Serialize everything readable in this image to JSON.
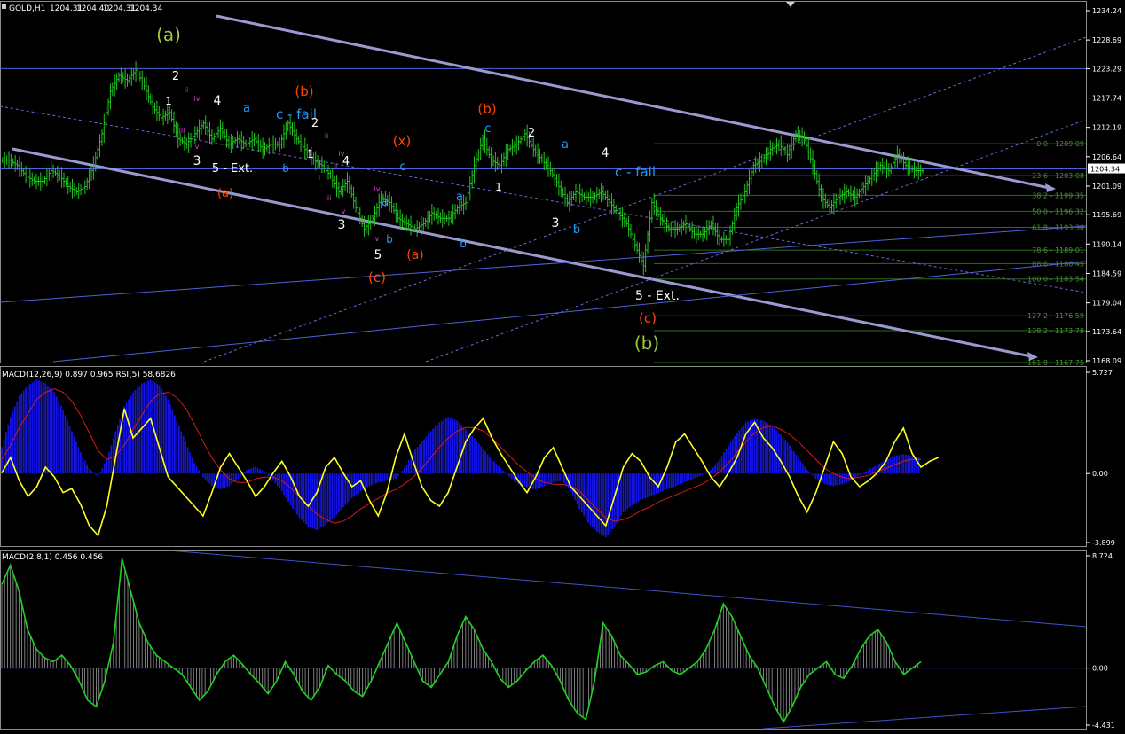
{
  "header": {
    "symbol": "GOLD,H1",
    "open": "1204.31",
    "high": "1204.40",
    "low": "1204.31",
    "close": "1204.34",
    "indicator1": "MACD(12,26,9) 0.897 0.965  RSI(5) 58.6826",
    "indicator2": "MACD(2,8,1) 0.456 0.456"
  },
  "chart_data": [
    {
      "type": "candlestick",
      "name": "price",
      "ylim": [
        1168.09,
        1234.24
      ],
      "yticks": [
        "1234.24",
        "1228.69",
        "1223.29",
        "1217.74",
        "1212.19",
        "1206.64",
        "1201.09",
        "1195.69",
        "1190.14",
        "1184.59",
        "1179.04",
        "1173.64",
        "1168.09"
      ],
      "current_price": "1204.34",
      "close_path": [
        1206,
        1205,
        1203,
        1202,
        1202,
        1204,
        1203,
        1201,
        1200,
        1201,
        1205,
        1211,
        1219,
        1222,
        1221,
        1223,
        1220,
        1216,
        1214,
        1215,
        1210,
        1209,
        1211,
        1213,
        1210,
        1212,
        1209,
        1210,
        1209,
        1210,
        1208,
        1209,
        1209,
        1213,
        1210,
        1208,
        1206,
        1205,
        1203,
        1200,
        1202,
        1197,
        1193,
        1195,
        1199,
        1198,
        1195,
        1194,
        1193,
        1194,
        1196,
        1195,
        1195,
        1197,
        1198,
        1205,
        1210,
        1206,
        1205,
        1208,
        1209,
        1211,
        1208,
        1206,
        1204,
        1201,
        1198,
        1200,
        1199,
        1199,
        1200,
        1198,
        1196,
        1194,
        1190,
        1186,
        1198,
        1195,
        1193,
        1193,
        1194,
        1192,
        1192,
        1194,
        1191,
        1191,
        1197,
        1200,
        1205,
        1206,
        1208,
        1209,
        1207,
        1211,
        1210,
        1205,
        1199,
        1197,
        1199,
        1200,
        1199,
        1201,
        1203,
        1205,
        1204,
        1207,
        1205,
        1204,
        1204
      ],
      "fib_levels": [
        {
          "label": "0.0 - 1209.09",
          "value": 1209.09
        },
        {
          "label": "23.6 - 1203.08",
          "value": 1203.08
        },
        {
          "label": "38.2 - 1199.35",
          "value": 1199.35
        },
        {
          "label": "50.0 - 1196.32",
          "value": 1196.32
        },
        {
          "label": "61.8 - 1193.30",
          "value": 1193.3
        },
        {
          "label": "78.6 - 1189.01",
          "value": 1189.01
        },
        {
          "label": "88.6 - 1186.45",
          "value": 1186.45
        },
        {
          "label": "100.0 - 1183.54",
          "value": 1183.54
        },
        {
          "label": "127.2 - 1176.59",
          "value": 1176.59
        },
        {
          "label": "138.2 - 1173.78",
          "value": 1173.78
        },
        {
          "label": "161.8 - 1167.75",
          "value": 1167.75
        }
      ],
      "wave_labels": [
        {
          "text": "(a)",
          "color": "#9acd32"
        },
        {
          "text": "(b)",
          "color": "#ff4500"
        },
        {
          "text": "(b)",
          "color": "#ff4500"
        },
        {
          "text": "(x)",
          "color": "#ff4500"
        },
        {
          "text": "(a)",
          "color": "#ff4500"
        },
        {
          "text": "(a)",
          "color": "#ff4500"
        },
        {
          "text": "(c)",
          "color": "#ff4500"
        },
        {
          "text": "(c)",
          "color": "#ff4500"
        },
        {
          "text": "(b)",
          "color": "#9acd32"
        },
        {
          "text": "a",
          "color": "#1e9bff"
        },
        {
          "text": "c - fail",
          "color": "#1e9bff"
        },
        {
          "text": "b",
          "color": "#1e9bff"
        },
        {
          "text": "c",
          "color": "#1e9bff"
        },
        {
          "text": "a",
          "color": "#1e9bff"
        },
        {
          "text": "b",
          "color": "#1e9bff"
        },
        {
          "text": "a",
          "color": "#1e9bff"
        },
        {
          "text": "b",
          "color": "#1e9bff"
        },
        {
          "text": "c",
          "color": "#1e9bff"
        },
        {
          "text": "a",
          "color": "#1e9bff"
        },
        {
          "text": "c - fail",
          "color": "#1e9bff"
        },
        {
          "text": "b",
          "color": "#1e9bff"
        },
        {
          "text": "2",
          "color": "#ffffff"
        },
        {
          "text": "1",
          "color": "#ffffff"
        },
        {
          "text": "4",
          "color": "#ffffff"
        },
        {
          "text": "3",
          "color": "#ffffff"
        },
        {
          "text": "5 - Ext.",
          "color": "#ffffff"
        },
        {
          "text": "2",
          "color": "#ffffff"
        },
        {
          "text": "1",
          "color": "#ffffff"
        },
        {
          "text": "4",
          "color": "#ffffff"
        },
        {
          "text": "3",
          "color": "#ffffff"
        },
        {
          "text": "5",
          "color": "#ffffff"
        },
        {
          "text": "2",
          "color": "#ffffff"
        },
        {
          "text": "1",
          "color": "#ffffff"
        },
        {
          "text": "4",
          "color": "#ffffff"
        },
        {
          "text": "3",
          "color": "#ffffff"
        },
        {
          "text": "5 - Ext.",
          "color": "#ffffff"
        },
        {
          "text": "ii",
          "color": "#e040e0"
        },
        {
          "text": "iv",
          "color": "#e040e0"
        },
        {
          "text": "iii",
          "color": "#e040e0"
        },
        {
          "text": "v",
          "color": "#e040e0"
        },
        {
          "text": "ii",
          "color": "#e040e0"
        },
        {
          "text": "iv",
          "color": "#e040e0"
        },
        {
          "text": "i",
          "color": "#e040e0"
        },
        {
          "text": "ii",
          "color": "#e040e0"
        },
        {
          "text": "iii",
          "color": "#e040e0"
        },
        {
          "text": "iv",
          "color": "#e040e0"
        },
        {
          "text": "v",
          "color": "#e040e0"
        },
        {
          "text": "iii",
          "color": "#e040e0"
        },
        {
          "text": "v",
          "color": "#e040e0"
        }
      ]
    },
    {
      "type": "histogram+line",
      "name": "MACD(12,26,9) / RSI(5)",
      "ylim": [
        -3.899,
        5.727
      ],
      "yticks": [
        "5.727",
        "0.00",
        "-3.899"
      ],
      "macd_values": [
        1.5,
        3.2,
        4.4,
        5.0,
        5.3,
        5.1,
        4.6,
        3.6,
        2.4,
        1.2,
        0.3,
        -0.2,
        0.8,
        2.4,
        3.8,
        4.6,
        5.1,
        5.3,
        5.0,
        4.2,
        3.0,
        1.8,
        0.6,
        -0.2,
        -0.7,
        -0.9,
        -0.7,
        -0.3,
        0.2,
        0.4,
        0.1,
        -0.4,
        -1.0,
        -1.8,
        -2.5,
        -3.0,
        -3.2,
        -2.9,
        -2.5,
        -1.9,
        -1.4,
        -1.0,
        -0.7,
        -0.5,
        -0.4,
        -0.3,
        0.3,
        1.2,
        1.8,
        2.4,
        2.9,
        3.2,
        3.0,
        2.5,
        2.0,
        1.4,
        0.8,
        0.3,
        -0.2,
        -0.6,
        -0.8,
        -0.9,
        -0.7,
        -0.5,
        -0.4,
        -1.0,
        -2.0,
        -2.8,
        -3.3,
        -3.6,
        -3.0,
        -2.2,
        -1.8,
        -1.5,
        -1.3,
        -1.1,
        -0.9,
        -0.7,
        -0.5,
        -0.3,
        -0.1,
        0.2,
        0.8,
        1.6,
        2.3,
        2.9,
        3.1,
        3.0,
        2.7,
        2.2,
        1.6,
        0.9,
        0.2,
        -0.3,
        -0.6,
        -0.7,
        -0.6,
        -0.4,
        -0.1,
        0.2,
        0.5,
        0.8,
        1.0,
        1.1,
        1.0,
        0.9
      ],
      "signal_values": [
        0.8,
        1.6,
        2.6,
        3.4,
        4.2,
        4.6,
        4.8,
        4.6,
        4.1,
        3.3,
        2.3,
        1.3,
        0.8,
        1.0,
        1.6,
        2.5,
        3.3,
        4.1,
        4.5,
        4.6,
        4.3,
        3.7,
        2.8,
        1.8,
        0.9,
        0.2,
        -0.3,
        -0.5,
        -0.5,
        -0.3,
        -0.2,
        -0.2,
        -0.4,
        -0.8,
        -1.3,
        -1.8,
        -2.3,
        -2.6,
        -2.8,
        -2.7,
        -2.4,
        -2.0,
        -1.7,
        -1.4,
        -1.1,
        -0.9,
        -0.6,
        -0.2,
        0.3,
        0.9,
        1.5,
        2.0,
        2.4,
        2.6,
        2.6,
        2.4,
        2.0,
        1.5,
        1.0,
        0.5,
        0.1,
        -0.3,
        -0.5,
        -0.6,
        -0.6,
        -0.7,
        -1.0,
        -1.5,
        -2.0,
        -2.5,
        -2.7,
        -2.6,
        -2.4,
        -2.1,
        -1.9,
        -1.6,
        -1.4,
        -1.2,
        -1.0,
        -0.8,
        -0.6,
        -0.3,
        0.1,
        0.6,
        1.2,
        1.8,
        2.3,
        2.6,
        2.7,
        2.5,
        2.2,
        1.8,
        1.3,
        0.8,
        0.3,
        0.0,
        -0.2,
        -0.3,
        -0.2,
        -0.1,
        0.1,
        0.3,
        0.5,
        0.7,
        0.8,
        0.8
      ],
      "rsi_values": [
        52,
        60,
        48,
        40,
        45,
        55,
        50,
        42,
        44,
        36,
        25,
        20,
        35,
        60,
        85,
        70,
        75,
        80,
        65,
        50,
        45,
        40,
        35,
        30,
        42,
        55,
        62,
        55,
        48,
        40,
        45,
        52,
        58,
        50,
        40,
        35,
        42,
        55,
        60,
        52,
        45,
        48,
        38,
        30,
        42,
        60,
        72,
        58,
        45,
        38,
        35,
        42,
        55,
        68,
        75,
        80,
        70,
        62,
        55,
        48,
        42,
        50,
        60,
        65,
        55,
        45,
        40,
        35,
        30,
        25,
        40,
        55,
        62,
        58,
        50,
        45,
        55,
        68,
        72,
        65,
        58,
        50,
        45,
        52,
        60,
        72,
        78,
        70,
        65,
        58,
        50,
        40,
        32,
        42,
        55,
        68,
        62,
        50,
        45,
        48,
        52,
        58,
        68,
        75,
        62,
        55,
        58,
        60
      ]
    },
    {
      "type": "histogram+line",
      "name": "MACD(2,8,1)",
      "ylim": [
        -4.431,
        8.724
      ],
      "yticks": [
        "8.724",
        "0.00",
        "-4.431"
      ],
      "values": [
        6.5,
        8.0,
        6.0,
        3.0,
        1.5,
        0.8,
        0.5,
        1.0,
        0.2,
        -1.0,
        -2.5,
        -3.0,
        -1.0,
        2.0,
        8.5,
        6.0,
        3.5,
        2.0,
        1.0,
        0.5,
        0.0,
        -0.5,
        -1.5,
        -2.5,
        -1.8,
        -0.5,
        0.5,
        1.0,
        0.3,
        -0.5,
        -1.2,
        -2.0,
        -1.0,
        0.5,
        -0.5,
        -1.8,
        -2.5,
        -1.5,
        0.2,
        -0.5,
        -1.0,
        -1.8,
        -2.2,
        -1.0,
        0.5,
        2.0,
        3.5,
        2.0,
        0.5,
        -1.0,
        -1.5,
        -0.5,
        0.5,
        2.5,
        4.0,
        3.0,
        1.5,
        0.5,
        -0.8,
        -1.5,
        -1.0,
        -0.2,
        0.5,
        1.0,
        0.2,
        -1.0,
        -2.5,
        -3.5,
        -4.0,
        -1.0,
        3.5,
        2.5,
        1.0,
        0.3,
        -0.5,
        -0.3,
        0.2,
        0.5,
        -0.2,
        -0.5,
        0.0,
        0.5,
        1.5,
        3.0,
        5.0,
        4.0,
        2.5,
        1.0,
        0.0,
        -1.5,
        -3.0,
        -4.2,
        -3.0,
        -1.5,
        -0.5,
        0.0,
        0.5,
        -0.5,
        -0.8,
        0.2,
        1.5,
        2.5,
        3.0,
        2.0,
        0.5,
        -0.5,
        0.0,
        0.5
      ]
    }
  ]
}
